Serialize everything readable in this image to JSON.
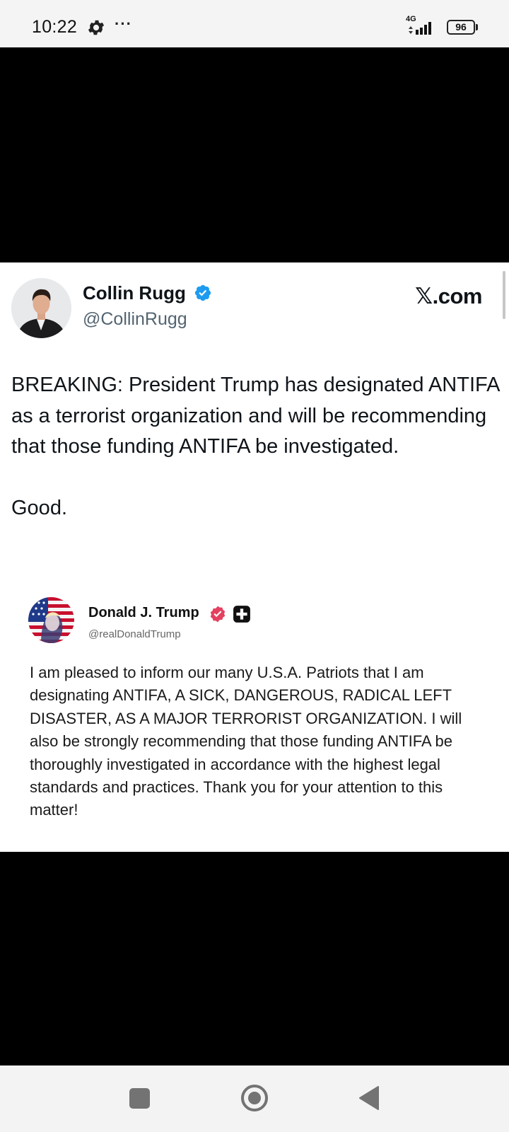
{
  "status_bar": {
    "time": "10:22",
    "network": "4G",
    "battery": "96"
  },
  "post": {
    "author_name": "Collin Rugg",
    "author_handle": "@CollinRugg",
    "site": "𝕏.com",
    "text_lines": [
      "BREAKING: President Trump has designated ANTIFA as a terrorist organization and will be recommending that those funding ANTIFA be investigated.",
      "Good."
    ]
  },
  "quoted_post": {
    "author_name": "Donald J. Trump",
    "author_handle": "@realDonaldTrump",
    "text": "I am pleased to inform our many U.S.A. Patriots that I am designating ANTIFA, A SICK, DANGEROUS, RADICAL LEFT DISASTER, AS A MAJOR TERRORIST ORGANIZATION. I will also be strongly recommending that those funding ANTIFA be thoroughly investigated in accordance with the highest legal standards and practices. Thank you for your attention to this matter!"
  },
  "colors": {
    "verified_blue": "#1d9bf0",
    "truth_verified": "#e4405f",
    "media_band": "#000000"
  },
  "icons": [
    "gear-icon",
    "signal-icon",
    "battery-icon",
    "verified-icon",
    "truth-verified-icon",
    "truth-social-plus-icon",
    "recents-icon",
    "home-icon",
    "back-icon"
  ]
}
